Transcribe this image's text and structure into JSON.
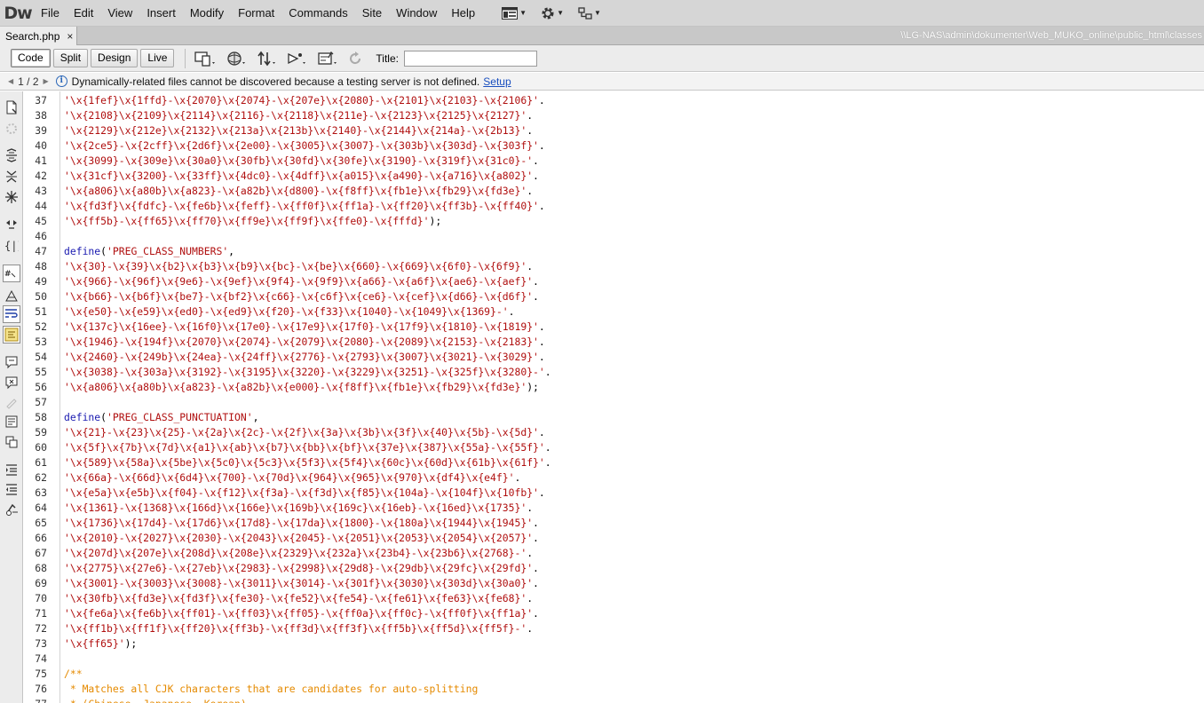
{
  "app": {
    "logo": "Dw",
    "menu": [
      "File",
      "Edit",
      "View",
      "Insert",
      "Modify",
      "Format",
      "Commands",
      "Site",
      "Window",
      "Help"
    ],
    "menu_icons": [
      "layout-icon",
      "gear-icon",
      "extensions-icon"
    ]
  },
  "tab": {
    "filename": "Search.php",
    "close": "×",
    "path": "\\\\LG-NAS\\admin\\dokumenter\\Web_MUKO_online\\public_html\\classes"
  },
  "toolbar": {
    "views": [
      "Code",
      "Split",
      "Design",
      "Live"
    ],
    "active_view": "Code",
    "title_label": "Title:",
    "title_value": ""
  },
  "infobar": {
    "page": "1 / 2",
    "message": "Dynamically-related files cannot be discovered because a testing server is not defined.",
    "link": "Setup"
  },
  "code_lines": [
    {
      "n": "37",
      "t": [
        [
          "s",
          "'\\x{1fef}\\x{1ffd}-\\x{2070}\\x{2074}-\\x{207e}\\x{2080}-\\x{2101}\\x{2103}-\\x{2106}'"
        ],
        [
          "p",
          "."
        ]
      ]
    },
    {
      "n": "38",
      "t": [
        [
          "s",
          "'\\x{2108}\\x{2109}\\x{2114}\\x{2116}-\\x{2118}\\x{211e}-\\x{2123}\\x{2125}\\x{2127}'"
        ],
        [
          "p",
          "."
        ]
      ]
    },
    {
      "n": "39",
      "t": [
        [
          "s",
          "'\\x{2129}\\x{212e}\\x{2132}\\x{213a}\\x{213b}\\x{2140}-\\x{2144}\\x{214a}-\\x{2b13}'"
        ],
        [
          "p",
          "."
        ]
      ]
    },
    {
      "n": "40",
      "t": [
        [
          "s",
          "'\\x{2ce5}-\\x{2cff}\\x{2d6f}\\x{2e00}-\\x{3005}\\x{3007}-\\x{303b}\\x{303d}-\\x{303f}'"
        ],
        [
          "p",
          "."
        ]
      ]
    },
    {
      "n": "41",
      "t": [
        [
          "s",
          "'\\x{3099}-\\x{309e}\\x{30a0}\\x{30fb}\\x{30fd}\\x{30fe}\\x{3190}-\\x{319f}\\x{31c0}-'"
        ],
        [
          "p",
          "."
        ]
      ]
    },
    {
      "n": "42",
      "t": [
        [
          "s",
          "'\\x{31cf}\\x{3200}-\\x{33ff}\\x{4dc0}-\\x{4dff}\\x{a015}\\x{a490}-\\x{a716}\\x{a802}'"
        ],
        [
          "p",
          "."
        ]
      ]
    },
    {
      "n": "43",
      "t": [
        [
          "s",
          "'\\x{a806}\\x{a80b}\\x{a823}-\\x{a82b}\\x{d800}-\\x{f8ff}\\x{fb1e}\\x{fb29}\\x{fd3e}'"
        ],
        [
          "p",
          "."
        ]
      ]
    },
    {
      "n": "44",
      "t": [
        [
          "s",
          "'\\x{fd3f}\\x{fdfc}-\\x{fe6b}\\x{feff}-\\x{ff0f}\\x{ff1a}-\\x{ff20}\\x{ff3b}-\\x{ff40}'"
        ],
        [
          "p",
          "."
        ]
      ]
    },
    {
      "n": "45",
      "t": [
        [
          "s",
          "'\\x{ff5b}-\\x{ff65}\\x{ff70}\\x{ff9e}\\x{ff9f}\\x{ffe0}-\\x{fffd}'"
        ],
        [
          "p",
          ");"
        ]
      ]
    },
    {
      "n": "46",
      "t": []
    },
    {
      "n": "47",
      "t": [
        [
          "f",
          "define"
        ],
        [
          "p",
          "("
        ],
        [
          "s",
          "'PREG_CLASS_NUMBERS'"
        ],
        [
          "p",
          ","
        ]
      ]
    },
    {
      "n": "48",
      "t": [
        [
          "s",
          "'\\x{30}-\\x{39}\\x{b2}\\x{b3}\\x{b9}\\x{bc}-\\x{be}\\x{660}-\\x{669}\\x{6f0}-\\x{6f9}'"
        ],
        [
          "p",
          "."
        ]
      ]
    },
    {
      "n": "49",
      "t": [
        [
          "s",
          "'\\x{966}-\\x{96f}\\x{9e6}-\\x{9ef}\\x{9f4}-\\x{9f9}\\x{a66}-\\x{a6f}\\x{ae6}-\\x{aef}'"
        ],
        [
          "p",
          "."
        ]
      ]
    },
    {
      "n": "50",
      "t": [
        [
          "s",
          "'\\x{b66}-\\x{b6f}\\x{be7}-\\x{bf2}\\x{c66}-\\x{c6f}\\x{ce6}-\\x{cef}\\x{d66}-\\x{d6f}'"
        ],
        [
          "p",
          "."
        ]
      ]
    },
    {
      "n": "51",
      "t": [
        [
          "s",
          "'\\x{e50}-\\x{e59}\\x{ed0}-\\x{ed9}\\x{f20}-\\x{f33}\\x{1040}-\\x{1049}\\x{1369}-'"
        ],
        [
          "p",
          "."
        ]
      ]
    },
    {
      "n": "52",
      "t": [
        [
          "s",
          "'\\x{137c}\\x{16ee}-\\x{16f0}\\x{17e0}-\\x{17e9}\\x{17f0}-\\x{17f9}\\x{1810}-\\x{1819}'"
        ],
        [
          "p",
          "."
        ]
      ]
    },
    {
      "n": "53",
      "t": [
        [
          "s",
          "'\\x{1946}-\\x{194f}\\x{2070}\\x{2074}-\\x{2079}\\x{2080}-\\x{2089}\\x{2153}-\\x{2183}'"
        ],
        [
          "p",
          "."
        ]
      ]
    },
    {
      "n": "54",
      "t": [
        [
          "s",
          "'\\x{2460}-\\x{249b}\\x{24ea}-\\x{24ff}\\x{2776}-\\x{2793}\\x{3007}\\x{3021}-\\x{3029}'"
        ],
        [
          "p",
          "."
        ]
      ]
    },
    {
      "n": "55",
      "t": [
        [
          "s",
          "'\\x{3038}-\\x{303a}\\x{3192}-\\x{3195}\\x{3220}-\\x{3229}\\x{3251}-\\x{325f}\\x{3280}-'"
        ],
        [
          "p",
          "."
        ]
      ]
    },
    {
      "n": "56",
      "t": [
        [
          "s",
          "'\\x{a806}\\x{a80b}\\x{a823}-\\x{a82b}\\x{e000}-\\x{f8ff}\\x{fb1e}\\x{fb29}\\x{fd3e}'"
        ],
        [
          "p",
          ");"
        ]
      ]
    },
    {
      "n": "57",
      "t": []
    },
    {
      "n": "58",
      "t": [
        [
          "f",
          "define"
        ],
        [
          "p",
          "("
        ],
        [
          "s",
          "'PREG_CLASS_PUNCTUATION'"
        ],
        [
          "p",
          ","
        ]
      ]
    },
    {
      "n": "59",
      "t": [
        [
          "s",
          "'\\x{21}-\\x{23}\\x{25}-\\x{2a}\\x{2c}-\\x{2f}\\x{3a}\\x{3b}\\x{3f}\\x{40}\\x{5b}-\\x{5d}'"
        ],
        [
          "p",
          "."
        ]
      ]
    },
    {
      "n": "60",
      "t": [
        [
          "s",
          "'\\x{5f}\\x{7b}\\x{7d}\\x{a1}\\x{ab}\\x{b7}\\x{bb}\\x{bf}\\x{37e}\\x{387}\\x{55a}-\\x{55f}'"
        ],
        [
          "p",
          "."
        ]
      ]
    },
    {
      "n": "61",
      "t": [
        [
          "s",
          "'\\x{589}\\x{58a}\\x{5be}\\x{5c0}\\x{5c3}\\x{5f3}\\x{5f4}\\x{60c}\\x{60d}\\x{61b}\\x{61f}'"
        ],
        [
          "p",
          "."
        ]
      ]
    },
    {
      "n": "62",
      "t": [
        [
          "s",
          "'\\x{66a}-\\x{66d}\\x{6d4}\\x{700}-\\x{70d}\\x{964}\\x{965}\\x{970}\\x{df4}\\x{e4f}'"
        ],
        [
          "p",
          "."
        ]
      ]
    },
    {
      "n": "63",
      "t": [
        [
          "s",
          "'\\x{e5a}\\x{e5b}\\x{f04}-\\x{f12}\\x{f3a}-\\x{f3d}\\x{f85}\\x{104a}-\\x{104f}\\x{10fb}'"
        ],
        [
          "p",
          "."
        ]
      ]
    },
    {
      "n": "64",
      "t": [
        [
          "s",
          "'\\x{1361}-\\x{1368}\\x{166d}\\x{166e}\\x{169b}\\x{169c}\\x{16eb}-\\x{16ed}\\x{1735}'"
        ],
        [
          "p",
          "."
        ]
      ]
    },
    {
      "n": "65",
      "t": [
        [
          "s",
          "'\\x{1736}\\x{17d4}-\\x{17d6}\\x{17d8}-\\x{17da}\\x{1800}-\\x{180a}\\x{1944}\\x{1945}'"
        ],
        [
          "p",
          "."
        ]
      ]
    },
    {
      "n": "66",
      "t": [
        [
          "s",
          "'\\x{2010}-\\x{2027}\\x{2030}-\\x{2043}\\x{2045}-\\x{2051}\\x{2053}\\x{2054}\\x{2057}'"
        ],
        [
          "p",
          "."
        ]
      ]
    },
    {
      "n": "67",
      "t": [
        [
          "s",
          "'\\x{207d}\\x{207e}\\x{208d}\\x{208e}\\x{2329}\\x{232a}\\x{23b4}-\\x{23b6}\\x{2768}-'"
        ],
        [
          "p",
          "."
        ]
      ]
    },
    {
      "n": "68",
      "t": [
        [
          "s",
          "'\\x{2775}\\x{27e6}-\\x{27eb}\\x{2983}-\\x{2998}\\x{29d8}-\\x{29db}\\x{29fc}\\x{29fd}'"
        ],
        [
          "p",
          "."
        ]
      ]
    },
    {
      "n": "69",
      "t": [
        [
          "s",
          "'\\x{3001}-\\x{3003}\\x{3008}-\\x{3011}\\x{3014}-\\x{301f}\\x{3030}\\x{303d}\\x{30a0}'"
        ],
        [
          "p",
          "."
        ]
      ]
    },
    {
      "n": "70",
      "t": [
        [
          "s",
          "'\\x{30fb}\\x{fd3e}\\x{fd3f}\\x{fe30}-\\x{fe52}\\x{fe54}-\\x{fe61}\\x{fe63}\\x{fe68}'"
        ],
        [
          "p",
          "."
        ]
      ]
    },
    {
      "n": "71",
      "t": [
        [
          "s",
          "'\\x{fe6a}\\x{fe6b}\\x{ff01}-\\x{ff03}\\x{ff05}-\\x{ff0a}\\x{ff0c}-\\x{ff0f}\\x{ff1a}'"
        ],
        [
          "p",
          "."
        ]
      ]
    },
    {
      "n": "72",
      "t": [
        [
          "s",
          "'\\x{ff1b}\\x{ff1f}\\x{ff20}\\x{ff3b}-\\x{ff3d}\\x{ff3f}\\x{ff5b}\\x{ff5d}\\x{ff5f}-'"
        ],
        [
          "p",
          "."
        ]
      ]
    },
    {
      "n": "73",
      "t": [
        [
          "s",
          "'\\x{ff65}'"
        ],
        [
          "p",
          ");"
        ]
      ]
    },
    {
      "n": "74",
      "t": []
    },
    {
      "n": "75",
      "t": [
        [
          "c",
          "/**"
        ]
      ]
    },
    {
      "n": "76",
      "t": [
        [
          "c",
          " * Matches all CJK characters that are candidates for auto-splitting"
        ]
      ]
    },
    {
      "n": "77",
      "t": [
        [
          "c",
          " * (Chinese, Japanese, Korean)."
        ]
      ]
    }
  ]
}
